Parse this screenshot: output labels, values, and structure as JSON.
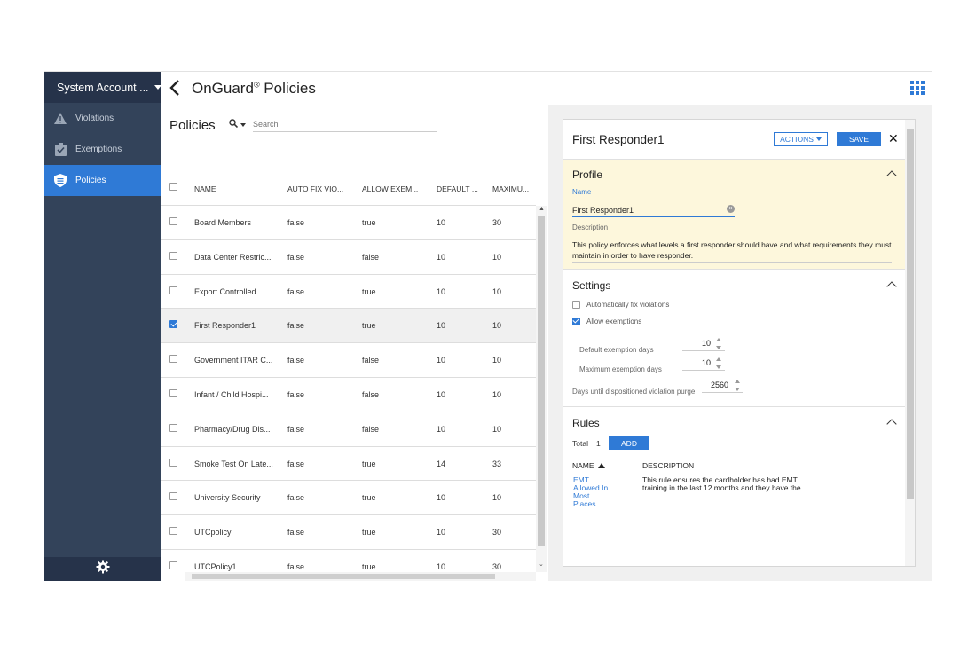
{
  "sidebar": {
    "account_label": "System Account ...",
    "items": [
      {
        "label": "Violations",
        "icon": "warning-icon",
        "active": false
      },
      {
        "label": "Exemptions",
        "icon": "clipboard-check-icon",
        "active": false
      },
      {
        "label": "Policies",
        "icon": "shield-icon",
        "active": true
      }
    ],
    "footer_icon": "gear-icon"
  },
  "header": {
    "title": "OnGuard",
    "title_mark": "®",
    "title_suffix": " Policies",
    "back_icon": "chevron-left-icon",
    "apps_icon": "grid-apps-icon"
  },
  "list": {
    "title": "Policies",
    "search_placeholder": "Search",
    "columns": [
      "NAME",
      "AUTO FIX VIO...",
      "ALLOW EXEM...",
      "DEFAULT ...",
      "MAXIMU..."
    ],
    "rows": [
      {
        "name": "Board Members",
        "auto": "false",
        "allow": "true",
        "def": "10",
        "max": "30",
        "checked": false
      },
      {
        "name": "Data Center Restric...",
        "auto": "false",
        "allow": "false",
        "def": "10",
        "max": "10",
        "checked": false
      },
      {
        "name": "Export Controlled",
        "auto": "false",
        "allow": "true",
        "def": "10",
        "max": "10",
        "checked": false
      },
      {
        "name": "First Responder1",
        "auto": "false",
        "allow": "true",
        "def": "10",
        "max": "10",
        "checked": true
      },
      {
        "name": "Government ITAR C...",
        "auto": "false",
        "allow": "false",
        "def": "10",
        "max": "10",
        "checked": false
      },
      {
        "name": "Infant / Child Hospi...",
        "auto": "false",
        "allow": "false",
        "def": "10",
        "max": "10",
        "checked": false
      },
      {
        "name": "Pharmacy/Drug Dis...",
        "auto": "false",
        "allow": "false",
        "def": "10",
        "max": "10",
        "checked": false
      },
      {
        "name": "Smoke Test On Late...",
        "auto": "false",
        "allow": "true",
        "def": "14",
        "max": "33",
        "checked": false
      },
      {
        "name": "University Security",
        "auto": "false",
        "allow": "true",
        "def": "10",
        "max": "10",
        "checked": false
      },
      {
        "name": "UTCpolicy",
        "auto": "false",
        "allow": "true",
        "def": "10",
        "max": "30",
        "checked": false
      },
      {
        "name": "UTCPolicy1",
        "auto": "false",
        "allow": "true",
        "def": "10",
        "max": "30",
        "checked": false
      }
    ]
  },
  "detail": {
    "title": "First Responder1",
    "actions_label": "ACTIONS",
    "save_label": "SAVE",
    "close_glyph": "✕",
    "profile": {
      "section": "Profile",
      "name_label": "Name",
      "name_value": "First Responder1",
      "description_label": "Description",
      "description_value": "This policy enforces what levels a first responder should have and what requirements they must maintain in order to have responder."
    },
    "settings": {
      "section": "Settings",
      "auto_fix_label": "Automatically fix violations",
      "auto_fix_checked": false,
      "allow_exemptions_label": "Allow exemptions",
      "allow_exemptions_checked": true,
      "default_days_label": "Default exemption days",
      "default_days_value": "10",
      "max_days_label": "Maximum exemption days",
      "max_days_value": "10",
      "purge_label": "Days until dispositioned violation purge",
      "purge_value": "2560"
    },
    "rules": {
      "section": "Rules",
      "total_label": "Total",
      "total_value": "1",
      "add_label": "ADD",
      "col_name": "NAME",
      "col_desc": "DESCRIPTION",
      "items": [
        {
          "name": "EMT Allowed In Most Places",
          "description": "This rule ensures the cardholder has had EMT training in the last 12 months and they have the"
        }
      ]
    }
  },
  "colors": {
    "accent": "#2f7ad6",
    "sidebar": "#33435a",
    "sidebar_dark": "#26334a",
    "profile_bg": "#fdf7dc"
  }
}
